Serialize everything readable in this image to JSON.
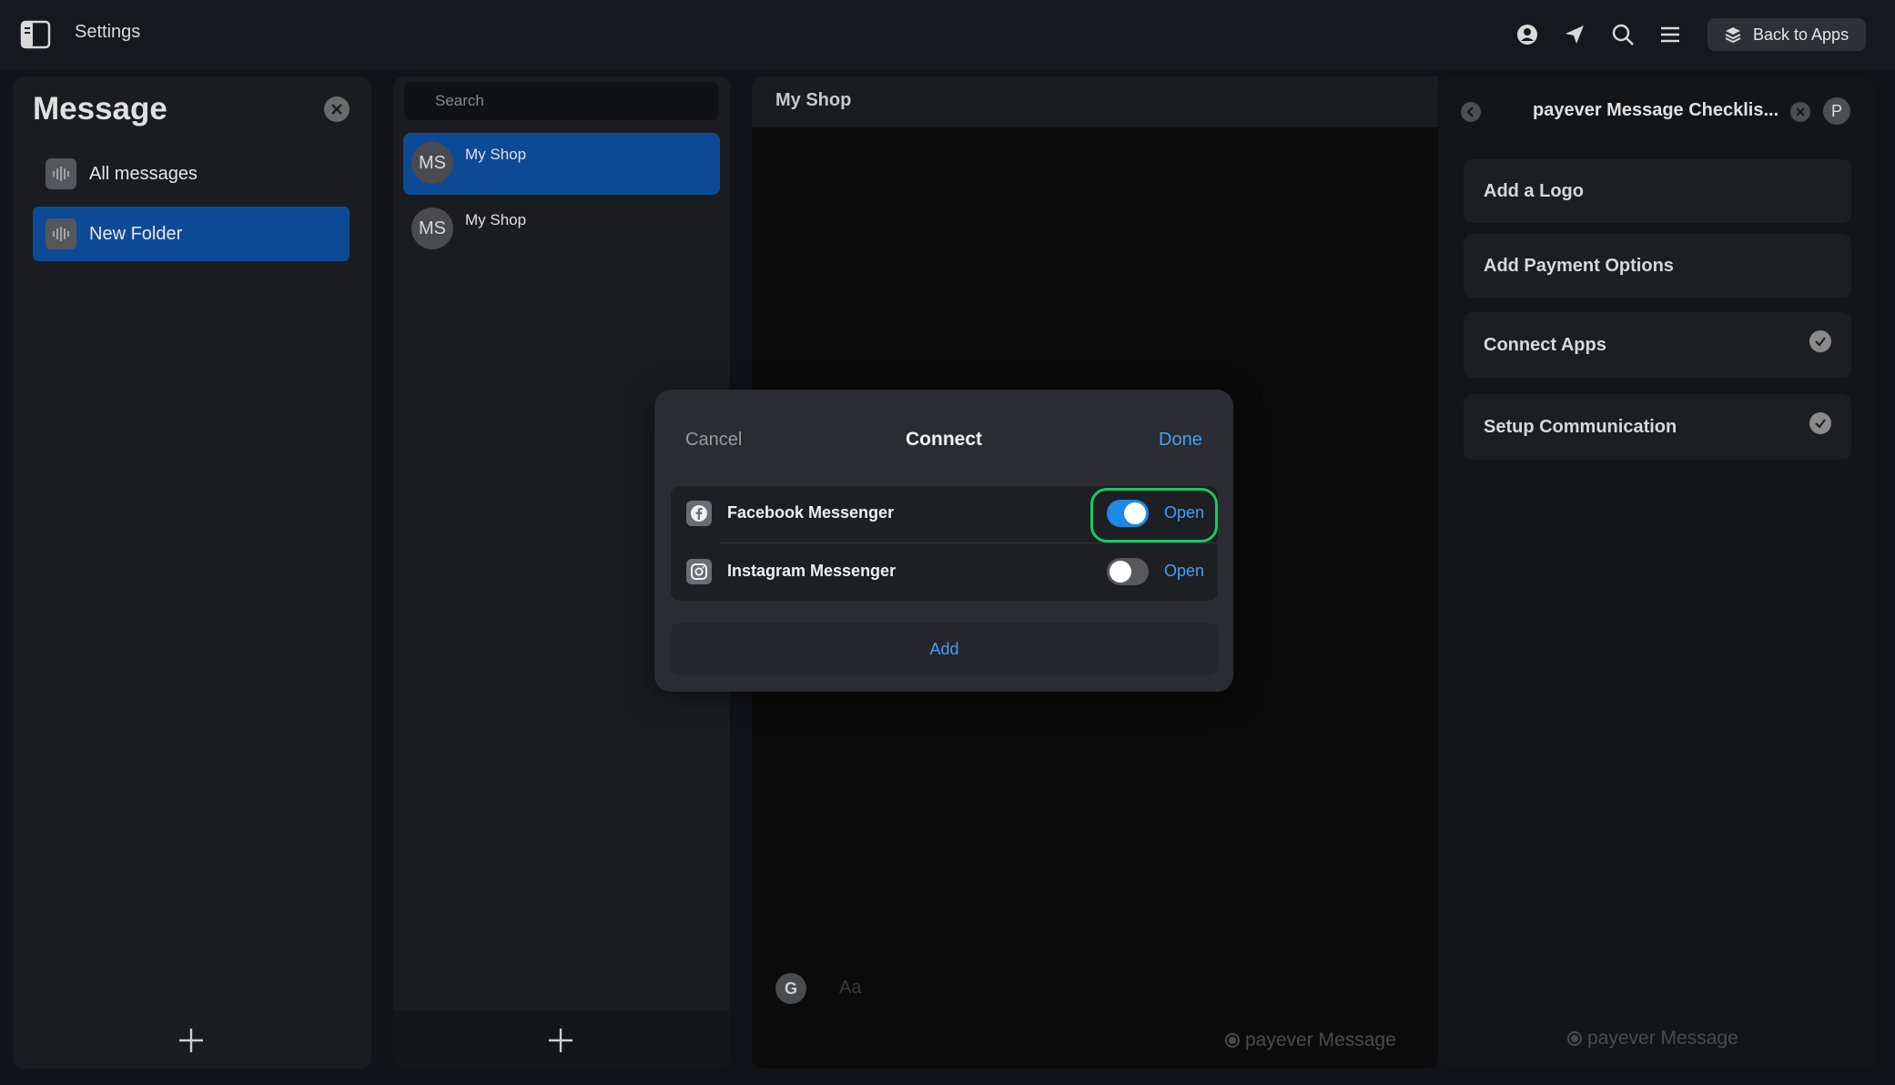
{
  "topbar": {
    "title": "Settings",
    "back_label": "Back to Apps",
    "icons": [
      "sidebar-toggle-icon",
      "user-icon",
      "send-icon",
      "search-icon",
      "menu-icon",
      "apps-icon"
    ]
  },
  "message_panel": {
    "title": "Message",
    "folders": [
      {
        "label": "All messages",
        "active": false
      },
      {
        "label": "New Folder",
        "active": true
      }
    ]
  },
  "list_panel": {
    "search_placeholder": "Search",
    "conversations": [
      {
        "avatar": "MS",
        "name": "My Shop",
        "active": true
      },
      {
        "avatar": "MS",
        "name": "My Shop",
        "active": false
      }
    ]
  },
  "chat_panel": {
    "title": "My Shop",
    "avatar_letter": "G",
    "input_placeholder": "Aa",
    "watermark": "payever Message"
  },
  "checklist_panel": {
    "title": "payever Message Checklis...",
    "avatar_letter": "P",
    "items": [
      {
        "label": "Add a Logo",
        "done": false
      },
      {
        "label": "Add Payment Options",
        "done": false
      },
      {
        "label": "Connect Apps",
        "done": true
      },
      {
        "label": "Setup Communication",
        "done": true
      }
    ],
    "watermark": "payever Message"
  },
  "modal": {
    "cancel_label": "Cancel",
    "title": "Connect",
    "done_label": "Done",
    "apps": [
      {
        "name": "Facebook Messenger",
        "enabled": true,
        "open_label": "Open",
        "icon": "facebook-icon"
      },
      {
        "name": "Instagram Messenger",
        "enabled": false,
        "open_label": "Open",
        "icon": "instagram-icon"
      }
    ],
    "add_label": "Add"
  },
  "colors": {
    "accent": "#1e88e5",
    "active_item": "#0d4a96",
    "link": "#3fa0ff",
    "highlight": "#17c964"
  }
}
